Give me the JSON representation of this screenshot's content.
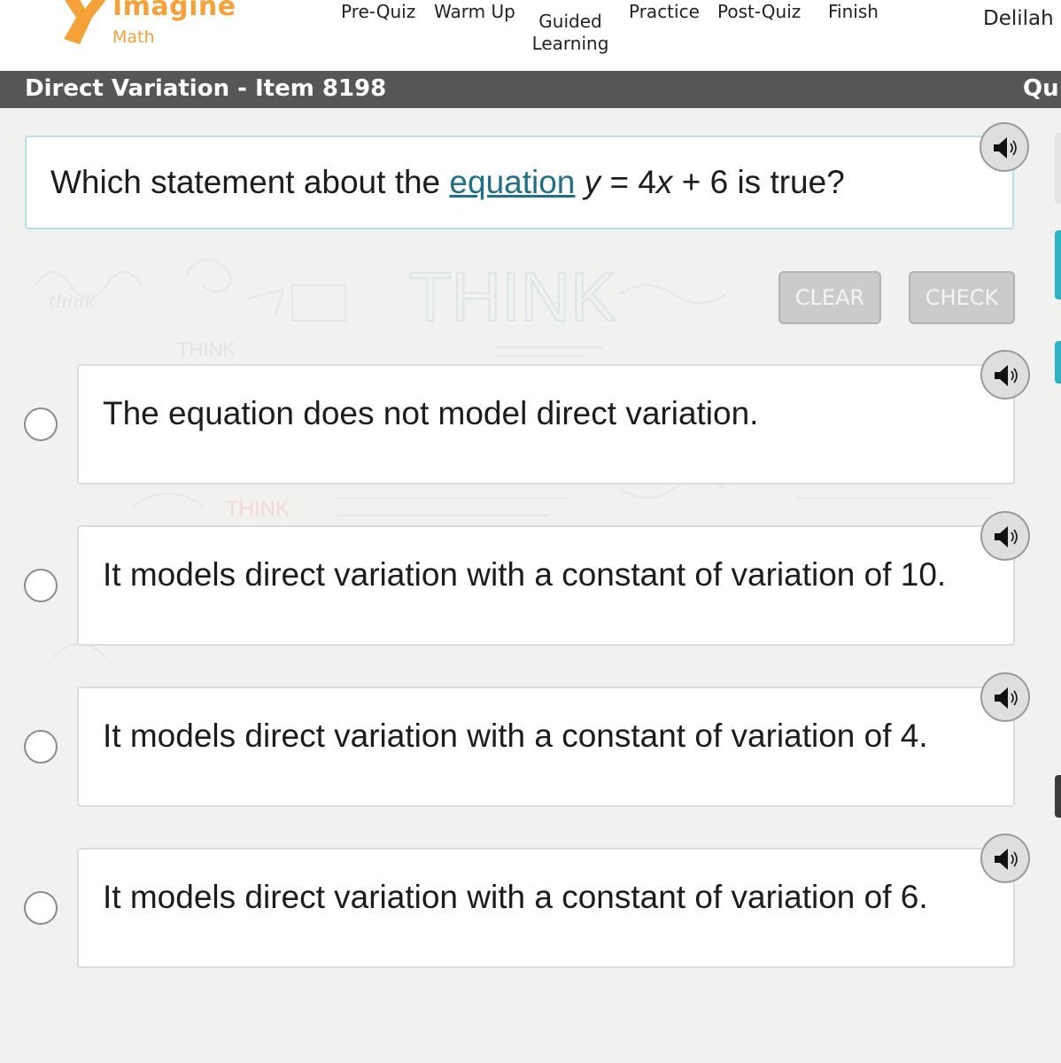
{
  "header": {
    "brand": "Imagine",
    "brand_sub": "Math",
    "nav": {
      "prequiz": "Pre-Quiz",
      "warmup": "Warm Up",
      "guided_line1": "Guided",
      "guided_line2": "Learning",
      "practice": "Practice",
      "postquiz": "Post-Quiz",
      "finish": "Finish"
    },
    "user": "Delilah"
  },
  "titlebar": {
    "title": "Direct Variation - Item 8198",
    "right_label": "Qu"
  },
  "question": {
    "prefix": "Which statement about the ",
    "link": "equation",
    "var_y": "y",
    "middle": " = 4",
    "var_x": "x",
    "suffix": " + 6 is true?"
  },
  "buttons": {
    "clear": "CLEAR",
    "check": "CHECK"
  },
  "answers": [
    {
      "text": "The equation does not model direct variation."
    },
    {
      "text": "It models direct variation with a constant of variation of 10."
    },
    {
      "text": "It models direct variation with a constant of variation of 4."
    },
    {
      "text": "It models direct variation with a constant of variation of 6."
    }
  ],
  "background_doodles": {
    "think_large": "THINK",
    "think_small": "THINK",
    "think_red": "THINK",
    "think_script": "think"
  },
  "colors": {
    "brand": "#f5a13a",
    "titlebar": "#545658",
    "link": "#1f6f86",
    "question_border": "#b9e0e8",
    "edge_teal": "#2bb3c4",
    "edge_dark": "#3a3b3d"
  },
  "icons": {
    "audio": "speaker-icon",
    "logo": "imagine-math-logo-icon"
  }
}
